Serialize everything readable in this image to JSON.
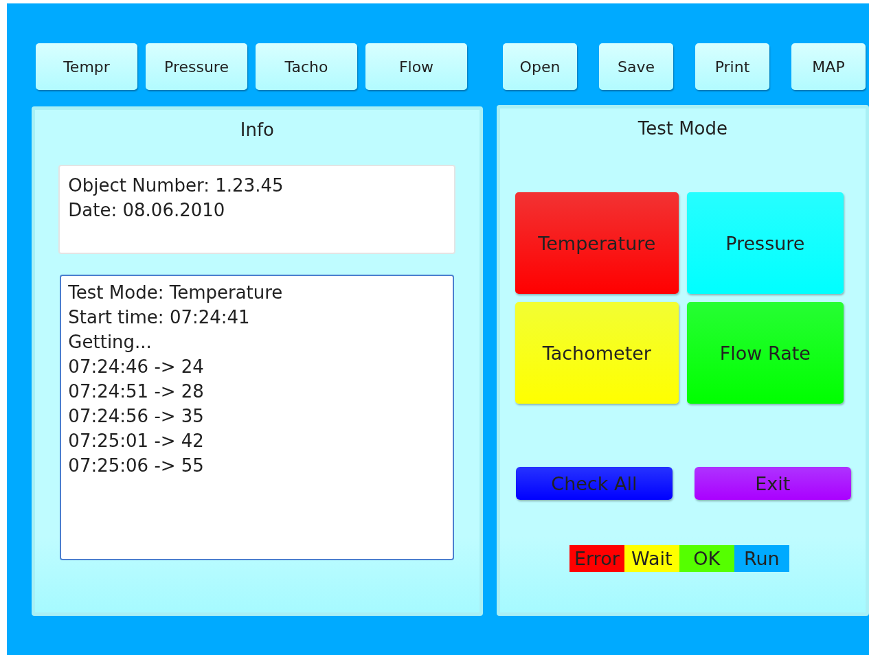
{
  "toolbar": {
    "left": [
      {
        "label": "Tempr"
      },
      {
        "label": "Pressure"
      },
      {
        "label": "Tacho"
      },
      {
        "label": "Flow"
      }
    ],
    "right": [
      {
        "label": "Open"
      },
      {
        "label": "Save"
      },
      {
        "label": "Print"
      },
      {
        "label": "MAP"
      }
    ]
  },
  "info_panel": {
    "title": "Info",
    "details": [
      "Object Number: 1.23.45",
      "Date: 08.06.2010"
    ],
    "log": [
      "Test Mode: Temperature",
      "Start time: 07:24:41",
      "Getting...",
      "07:24:46 -> 24",
      "07:24:51 -> 28",
      "07:24:56 -> 35",
      "07:25:01 -> 42",
      "07:25:06 -> 55"
    ]
  },
  "test_mode_panel": {
    "title": "Test Mode",
    "modes": [
      {
        "label": "Temperature",
        "color": "#ff0000"
      },
      {
        "label": "Pressure",
        "color": "#00ffff"
      },
      {
        "label": "Tachometer",
        "color": "#ffff00"
      },
      {
        "label": "Flow Rate",
        "color": "#00ff00"
      }
    ],
    "actions": [
      {
        "label": "Check All",
        "color": "#0000ff"
      },
      {
        "label": "Exit",
        "color": "#aa00ff"
      }
    ],
    "legend": [
      {
        "label": "Error",
        "color": "#ff0000"
      },
      {
        "label": "Wait",
        "color": "#ffff00"
      },
      {
        "label": "OK",
        "color": "#55ff00"
      },
      {
        "label": "Run",
        "color": "#00aaff"
      }
    ]
  }
}
